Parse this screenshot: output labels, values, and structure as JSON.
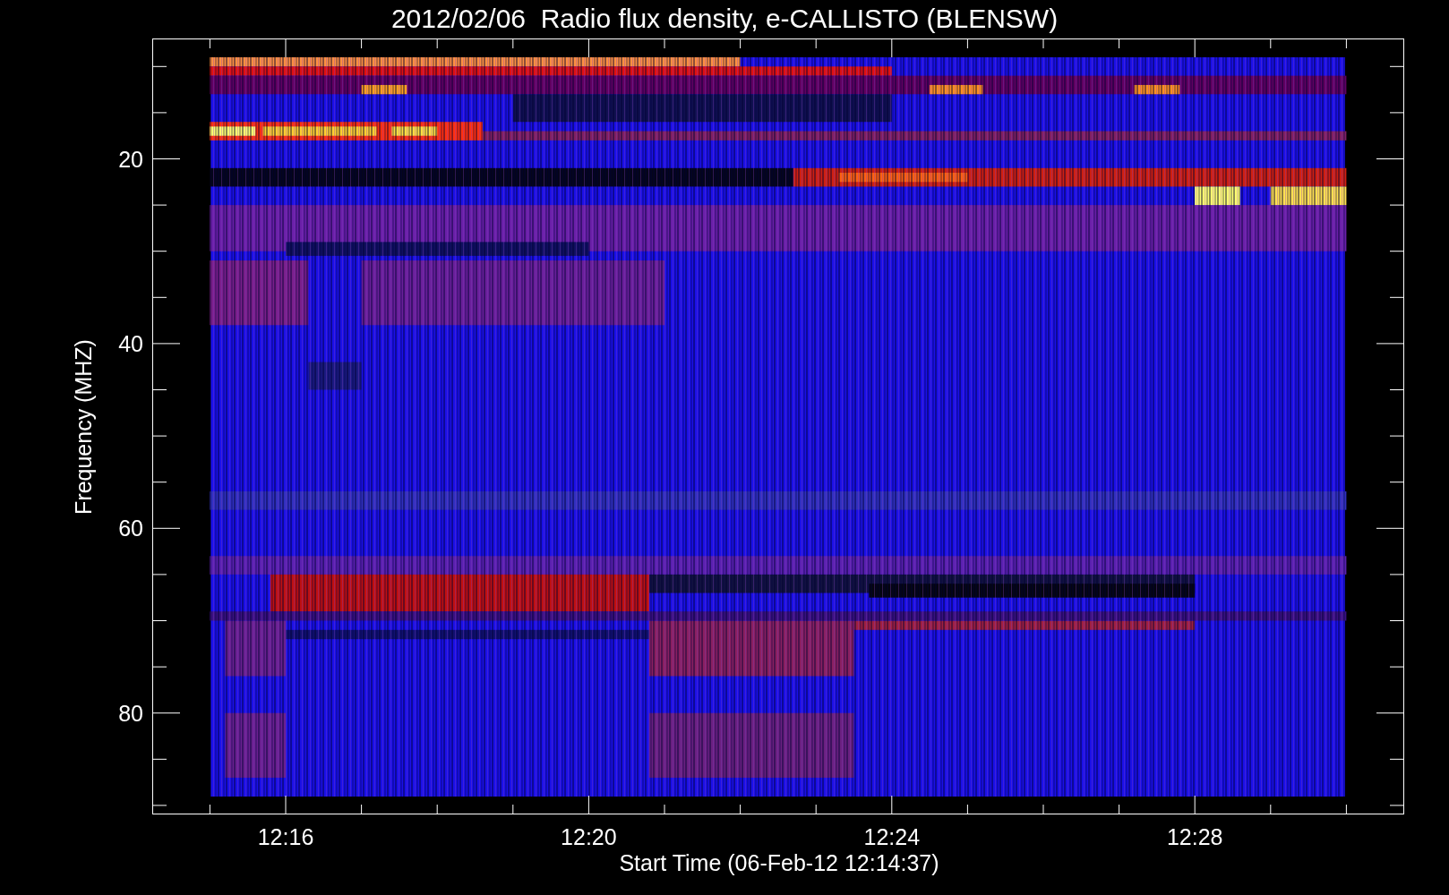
{
  "plot": {
    "title": "2012/02/06  Radio flux density, e-CALLISTO (BLENSW)",
    "y_label": "Frequency (MHZ)",
    "x_label": "Start Time (06-Feb-12 12:14:37)",
    "y_ticks": [
      "20",
      "40",
      "60",
      "80"
    ],
    "x_ticks": [
      "12:16",
      "12:20",
      "12:24",
      "12:28"
    ]
  }
}
